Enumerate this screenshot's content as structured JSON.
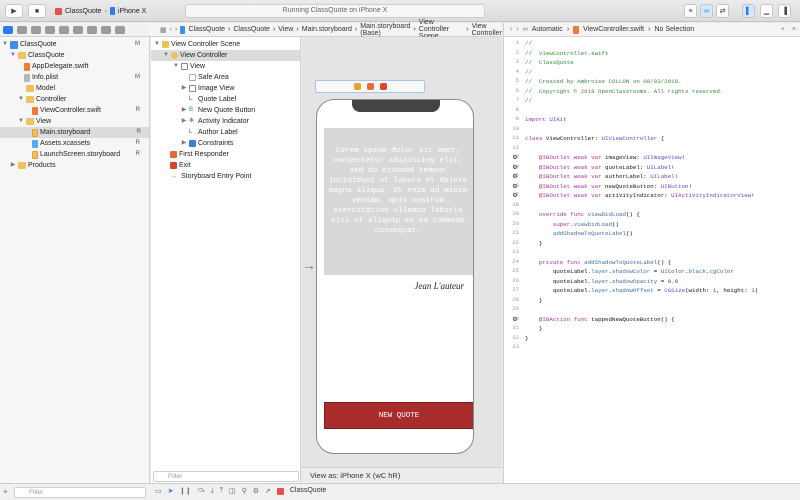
{
  "toolbar": {
    "scheme_name": "ClassQuote",
    "device": "iPhone X",
    "activity": "Running ClassQuote on iPhone X"
  },
  "navigator": {
    "filter_placeholder": "Filter",
    "items": [
      {
        "label": "ClassQuote",
        "badge": "M",
        "kind": "project",
        "level": 0
      },
      {
        "label": "ClassQuote",
        "badge": "",
        "kind": "folder",
        "level": 1
      },
      {
        "label": "AppDelegate.swift",
        "badge": "",
        "kind": "swift",
        "level": 2
      },
      {
        "label": "Info.plist",
        "badge": "M",
        "kind": "plist",
        "level": 2
      },
      {
        "label": "Model",
        "badge": "",
        "kind": "folder",
        "level": 2
      },
      {
        "label": "Controller",
        "badge": "",
        "kind": "folder",
        "level": 2
      },
      {
        "label": "ViewController.swift",
        "badge": "R",
        "kind": "swift",
        "level": 3
      },
      {
        "label": "View",
        "badge": "",
        "kind": "folder",
        "level": 2
      },
      {
        "label": "Main.storyboard",
        "badge": "R",
        "kind": "storyboard",
        "level": 3
      },
      {
        "label": "Assets.xcassets",
        "badge": "R",
        "kind": "assets",
        "level": 3
      },
      {
        "label": "LaunchScreen.storyboard",
        "badge": "R",
        "kind": "storyboard",
        "level": 3
      },
      {
        "label": "Products",
        "badge": "",
        "kind": "folder",
        "level": 1
      }
    ]
  },
  "outline": {
    "scene_title": "View Controller Scene",
    "filter_placeholder": "Filter",
    "items": [
      {
        "label": "View Controller",
        "level": 1
      },
      {
        "label": "View",
        "level": 2
      },
      {
        "label": "Safe Area",
        "level": 3
      },
      {
        "label": "Image View",
        "level": 3
      },
      {
        "label": "Quote Label",
        "level": 3
      },
      {
        "label": "New Quote Button",
        "level": 3
      },
      {
        "label": "Activity Indicator",
        "level": 3
      },
      {
        "label": "Author Label",
        "level": 3
      },
      {
        "label": "Constraints",
        "level": 3
      },
      {
        "label": "First Responder",
        "level": 1
      },
      {
        "label": "Exit",
        "level": 1
      },
      {
        "label": "Storyboard Entry Point",
        "level": 1
      }
    ]
  },
  "jumpbar": {
    "crumbs": [
      "ClassQuote",
      "ClassQuote",
      "View",
      "Main.storyboard",
      "Main.storyboard (Base)",
      "View Controller Scene",
      "View Controller"
    ]
  },
  "canvas": {
    "quote_text": "Lorem ipsum dolor sit amet, consectetur adipiscing elit, sed do eiusmod tempor incididunt ut labore et dolore magna aliqua. Ut enim ad minim veniam, quis nostrud exercitation ullamco laboris nisi ut aliquip ex ea commodo consequat.",
    "author": "Jean L'auteur",
    "button_label": "NEW QUOTE",
    "view_as": "View as: iPhone X (wC hR)"
  },
  "editor": {
    "jumpbar": [
      "Automatic",
      "ViewController.swift",
      "No Selection"
    ],
    "lines": [
      "//",
      "//  ViewController.swift",
      "//  ClassQuote",
      "//",
      "//  Created by Ambroise COLLON on 08/03/2018.",
      "//  Copyright © 2018 OpenClassrooms. All rights reserved.",
      "//",
      "",
      "import UIKit",
      "",
      "class ViewController: UIViewController {",
      "",
      "    @IBOutlet weak var imageView: UIImageView!",
      "    @IBOutlet weak var quoteLabel: UILabel!",
      "    @IBOutlet weak var authorLabel: UILabel!",
      "    @IBOutlet weak var newQuoteButton: UIButton!",
      "    @IBOutlet weak var activityIndicator: UIActivityIndicatorView!",
      "",
      "    override func viewDidLoad() {",
      "        super.viewDidLoad()",
      "        addShadowToQuoteLabel()",
      "    }",
      "",
      "    private func addShadowToQuoteLabel() {",
      "        quoteLabel.layer.shadowColor = UIColor.black.cgColor",
      "        quoteLabel.layer.shadowOpacity = 0.9",
      "        quoteLabel.layer.shadowOffset = CGSize(width: 1, height: 1)",
      "    }",
      "",
      "    @IBAction func tappedNewQuoteButton() {",
      "    }",
      "}",
      ""
    ]
  },
  "bottom": {
    "target": "ClassQuote"
  },
  "colors": {
    "accent": "#2b7bf4",
    "button_red": "#a82c2c",
    "quote_bg": "#d8d8d8"
  }
}
